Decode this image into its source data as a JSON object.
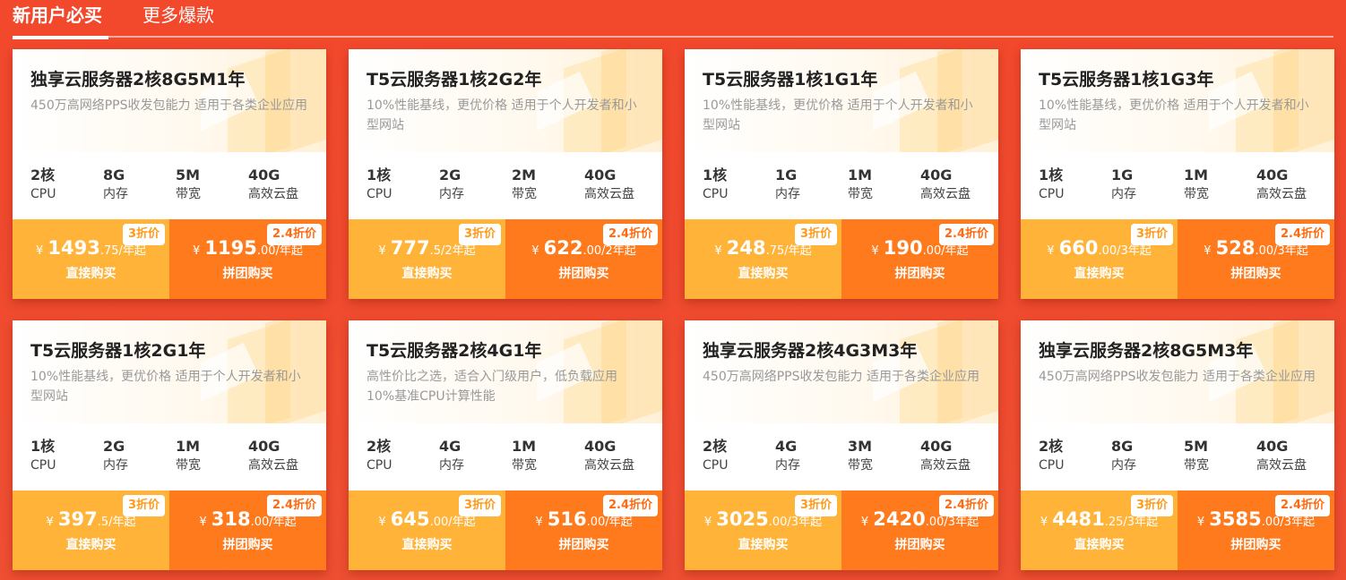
{
  "tabs": [
    {
      "label": "新用户必买"
    },
    {
      "label": "更多爆款"
    }
  ],
  "labels": {
    "currency": "¥",
    "direct_buy": "直接购买",
    "group_buy": "拼团购买",
    "badge_direct": "3折价",
    "badge_group": "2.4折价"
  },
  "products": [
    {
      "title": "独享云服务器2核8G5M1年",
      "desc": "450万高网络PPS收发包能力 适用于各类企业应用",
      "specs": [
        {
          "v": "2核",
          "l": "CPU"
        },
        {
          "v": "8G",
          "l": "内存"
        },
        {
          "v": "5M",
          "l": "带宽"
        },
        {
          "v": "40G",
          "l": "高效云盘"
        }
      ],
      "direct": {
        "int": "1493",
        "rest": ".75/年起"
      },
      "group": {
        "int": "1195",
        "rest": ".00/年起"
      }
    },
    {
      "title": "T5云服务器1核2G2年",
      "desc": "10%性能基线，更优价格 适用于个人开发者和小型网站",
      "specs": [
        {
          "v": "1核",
          "l": "CPU"
        },
        {
          "v": "2G",
          "l": "内存"
        },
        {
          "v": "2M",
          "l": "带宽"
        },
        {
          "v": "40G",
          "l": "高效云盘"
        }
      ],
      "direct": {
        "int": "777",
        "rest": ".5/2年起"
      },
      "group": {
        "int": "622",
        "rest": ".00/2年起"
      }
    },
    {
      "title": "T5云服务器1核1G1年",
      "desc": "10%性能基线，更优价格 适用于个人开发者和小型网站",
      "specs": [
        {
          "v": "1核",
          "l": "CPU"
        },
        {
          "v": "1G",
          "l": "内存"
        },
        {
          "v": "1M",
          "l": "带宽"
        },
        {
          "v": "40G",
          "l": "高效云盘"
        }
      ],
      "direct": {
        "int": "248",
        "rest": ".75/年起"
      },
      "group": {
        "int": "190",
        "rest": ".00/年起"
      }
    },
    {
      "title": "T5云服务器1核1G3年",
      "desc": "10%性能基线，更优价格 适用于个人开发者和小型网站",
      "specs": [
        {
          "v": "1核",
          "l": "CPU"
        },
        {
          "v": "1G",
          "l": "内存"
        },
        {
          "v": "1M",
          "l": "带宽"
        },
        {
          "v": "40G",
          "l": "高效云盘"
        }
      ],
      "direct": {
        "int": "660",
        "rest": ".00/3年起"
      },
      "group": {
        "int": "528",
        "rest": ".00/3年起"
      }
    },
    {
      "title": "T5云服务器1核2G1年",
      "desc": "10%性能基线，更优价格 适用于个人开发者和小型网站",
      "specs": [
        {
          "v": "1核",
          "l": "CPU"
        },
        {
          "v": "2G",
          "l": "内存"
        },
        {
          "v": "1M",
          "l": "带宽"
        },
        {
          "v": "40G",
          "l": "高效云盘"
        }
      ],
      "direct": {
        "int": "397",
        "rest": ".5/年起"
      },
      "group": {
        "int": "318",
        "rest": ".00/年起"
      }
    },
    {
      "title": "T5云服务器2核4G1年",
      "desc": "高性价比之选，适合入门级用户，低负载应用10%基准CPU计算性能",
      "specs": [
        {
          "v": "2核",
          "l": "CPU"
        },
        {
          "v": "4G",
          "l": "内存"
        },
        {
          "v": "1M",
          "l": "带宽"
        },
        {
          "v": "40G",
          "l": "高效云盘"
        }
      ],
      "direct": {
        "int": "645",
        "rest": ".00/年起"
      },
      "group": {
        "int": "516",
        "rest": ".00/年起"
      }
    },
    {
      "title": "独享云服务器2核4G3M3年",
      "desc": "450万高网络PPS收发包能力 适用于各类企业应用",
      "specs": [
        {
          "v": "2核",
          "l": "CPU"
        },
        {
          "v": "4G",
          "l": "内存"
        },
        {
          "v": "3M",
          "l": "带宽"
        },
        {
          "v": "40G",
          "l": "高效云盘"
        }
      ],
      "direct": {
        "int": "3025",
        "rest": ".00/3年起"
      },
      "group": {
        "int": "2420",
        "rest": ".00/3年起"
      }
    },
    {
      "title": "独享云服务器2核8G5M3年",
      "desc": "450万高网络PPS收发包能力 适用于各类企业应用",
      "specs": [
        {
          "v": "2核",
          "l": "CPU"
        },
        {
          "v": "8G",
          "l": "内存"
        },
        {
          "v": "5M",
          "l": "带宽"
        },
        {
          "v": "40G",
          "l": "高效云盘"
        }
      ],
      "direct": {
        "int": "4481",
        "rest": ".25/3年起"
      },
      "group": {
        "int": "3585",
        "rest": ".00/3年起"
      }
    }
  ]
}
